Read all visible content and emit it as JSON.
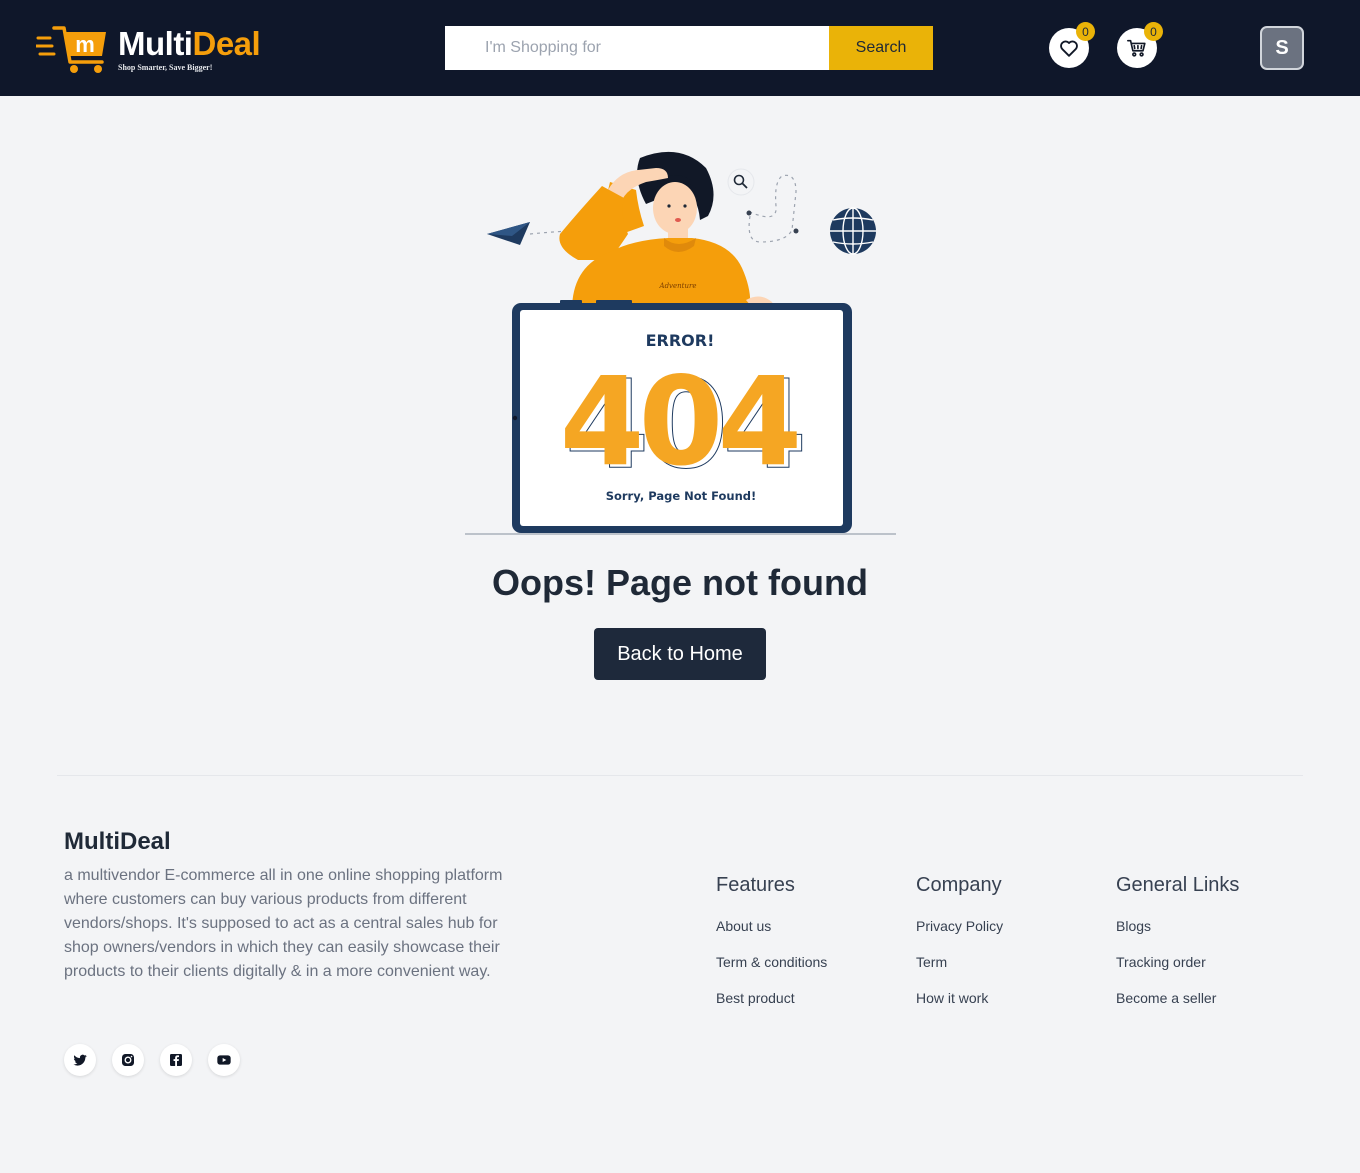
{
  "header": {
    "logo": {
      "word1": "Multi",
      "word2": "Deal",
      "tagline": "Shop Smarter, Save Bigger!"
    },
    "search": {
      "placeholder": "I'm Shopping for",
      "value": "",
      "button_label": "Search"
    },
    "wishlist": {
      "icon": "heart-icon",
      "count": "0"
    },
    "cart": {
      "icon": "cart-icon",
      "count": "0"
    },
    "avatar_initial": "S"
  },
  "illustration": {
    "screen_heading": "ERROR!",
    "code": "404",
    "screen_subtitle": "Sorry, Page Not Found!",
    "sweater_text": "Adventure"
  },
  "main": {
    "title": "Oops! Page not found",
    "home_button": "Back to Home"
  },
  "footer": {
    "brand": "MultiDeal",
    "description": "a multivendor E-commerce all in one online shopping platform where customers can buy various products from different vendors/shops. It's supposed to act as a central sales hub for shop owners/vendors in which they can easily showcase their products to their clients digitally & in a more convenient way.",
    "socials": [
      "twitter-icon",
      "instagram-icon",
      "facebook-icon",
      "youtube-icon"
    ],
    "columns": [
      {
        "title": "Features",
        "links": [
          "About us",
          "Term & conditions",
          "Best product"
        ]
      },
      {
        "title": "Company",
        "links": [
          "Privacy Policy",
          "Term",
          "How it work"
        ]
      },
      {
        "title": "General Links",
        "links": [
          "Blogs",
          "Tracking order",
          "Become a seller"
        ]
      }
    ]
  },
  "colors": {
    "header_bg": "#0f172a",
    "accent": "#eab308",
    "brand_orange": "#f59e0b",
    "button_dark": "#1e293b",
    "page_bg": "#f3f4f6"
  }
}
